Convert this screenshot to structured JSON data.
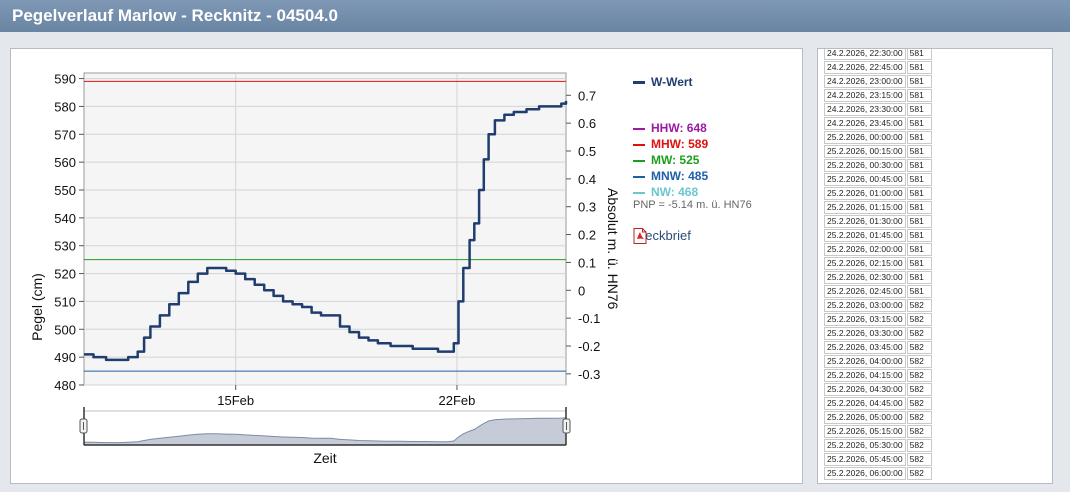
{
  "header": {
    "title": "Pegelverlauf Marlow - Recknitz - 04504.0"
  },
  "chart_data": {
    "type": "line",
    "ylabel": "Pegel (cm)",
    "y2label": "Absolut m. ü. HN76",
    "xlabel": "Zeit",
    "ylim": [
      480,
      592
    ],
    "y_ticks": [
      480,
      490,
      500,
      510,
      520,
      530,
      540,
      550,
      560,
      570,
      580,
      590
    ],
    "y2_ticks": [
      0.7,
      0.6,
      0.5,
      0.4,
      0.3,
      0.2,
      0.1,
      0,
      -0.1,
      -0.2,
      -0.3
    ],
    "y2_tick_labels": [
      "0.7",
      "0.6",
      "0.5",
      "0.4",
      "0.3",
      "0.2",
      "0.1",
      "0",
      "-0.1",
      "-0.2",
      "-0.3"
    ],
    "y2_offset_cm": 514,
    "x_ticks": [
      {
        "label": "15Feb",
        "x": 14.8
      },
      {
        "label": "22Feb",
        "x": 21.8
      }
    ],
    "xlim": [
      10.0,
      25.25
    ],
    "series": [
      {
        "name": "W-Wert",
        "color": "#1f3d6e",
        "points": [
          [
            10.0,
            491
          ],
          [
            10.3,
            490
          ],
          [
            10.7,
            489
          ],
          [
            11.1,
            489
          ],
          [
            11.4,
            490
          ],
          [
            11.7,
            492
          ],
          [
            11.9,
            497
          ],
          [
            12.1,
            501
          ],
          [
            12.4,
            505
          ],
          [
            12.7,
            509
          ],
          [
            13.0,
            513
          ],
          [
            13.3,
            517
          ],
          [
            13.6,
            520
          ],
          [
            13.9,
            522
          ],
          [
            14.2,
            522
          ],
          [
            14.5,
            521
          ],
          [
            14.8,
            520
          ],
          [
            15.1,
            518
          ],
          [
            15.4,
            516
          ],
          [
            15.7,
            514
          ],
          [
            16.0,
            512
          ],
          [
            16.3,
            510
          ],
          [
            16.6,
            509
          ],
          [
            16.9,
            508
          ],
          [
            17.2,
            506
          ],
          [
            17.5,
            505
          ],
          [
            17.8,
            505
          ],
          [
            18.1,
            501
          ],
          [
            18.4,
            499
          ],
          [
            18.7,
            497
          ],
          [
            19.0,
            496
          ],
          [
            19.3,
            495
          ],
          [
            19.7,
            494
          ],
          [
            20.0,
            494
          ],
          [
            20.4,
            493
          ],
          [
            20.8,
            493
          ],
          [
            21.2,
            492
          ],
          [
            21.5,
            492
          ],
          [
            21.7,
            495
          ],
          [
            21.85,
            510
          ],
          [
            22.0,
            522
          ],
          [
            22.2,
            532
          ],
          [
            22.35,
            538
          ],
          [
            22.5,
            550
          ],
          [
            22.65,
            561
          ],
          [
            22.8,
            570
          ],
          [
            23.0,
            575
          ],
          [
            23.3,
            577
          ],
          [
            23.6,
            578
          ],
          [
            24.0,
            579
          ],
          [
            24.4,
            580
          ],
          [
            24.8,
            580
          ],
          [
            25.1,
            581
          ],
          [
            25.25,
            582
          ]
        ]
      }
    ],
    "reference_lines": [
      {
        "name": "HHW",
        "value": 648,
        "color": "#9b1aa3"
      },
      {
        "name": "MHW",
        "value": 589,
        "color": "#e01010"
      },
      {
        "name": "MW",
        "value": 525,
        "color": "#1f9d1f"
      },
      {
        "name": "MNW",
        "value": 485,
        "color": "#1f5fa8"
      },
      {
        "name": "NW",
        "value": 468,
        "color": "#6cc6cf"
      }
    ],
    "legend_placement": "right",
    "grid": true
  },
  "legend": {
    "series_label": "W-Wert",
    "refs": [
      {
        "label": "HHW: 648",
        "color": "#9b1aa3"
      },
      {
        "label": "MHW: 589",
        "color": "#e01010"
      },
      {
        "label": "MW: 525",
        "color": "#1f9d1f"
      },
      {
        "label": "MNW: 485",
        "color": "#1f5fa8"
      },
      {
        "label": "NW: 468",
        "color": "#6cc6cf"
      }
    ],
    "pnp": "PNP = -5.14 m. ü. HN76",
    "steckbrief": "Steckbrief"
  },
  "navigator": {
    "label": "Zeit"
  },
  "table": {
    "rows": [
      [
        "24.2.2026, 22:30:00",
        "581"
      ],
      [
        "24.2.2026, 22:45:00",
        "581"
      ],
      [
        "24.2.2026, 23:00:00",
        "581"
      ],
      [
        "24.2.2026, 23:15:00",
        "581"
      ],
      [
        "24.2.2026, 23:30:00",
        "581"
      ],
      [
        "24.2.2026, 23:45:00",
        "581"
      ],
      [
        "25.2.2026, 00:00:00",
        "581"
      ],
      [
        "25.2.2026, 00:15:00",
        "581"
      ],
      [
        "25.2.2026, 00:30:00",
        "581"
      ],
      [
        "25.2.2026, 00:45:00",
        "581"
      ],
      [
        "25.2.2026, 01:00:00",
        "581"
      ],
      [
        "25.2.2026, 01:15:00",
        "581"
      ],
      [
        "25.2.2026, 01:30:00",
        "581"
      ],
      [
        "25.2.2026, 01:45:00",
        "581"
      ],
      [
        "25.2.2026, 02:00:00",
        "581"
      ],
      [
        "25.2.2026, 02:15:00",
        "581"
      ],
      [
        "25.2.2026, 02:30:00",
        "581"
      ],
      [
        "25.2.2026, 02:45:00",
        "581"
      ],
      [
        "25.2.2026, 03:00:00",
        "582"
      ],
      [
        "25.2.2026, 03:15:00",
        "582"
      ],
      [
        "25.2.2026, 03:30:00",
        "582"
      ],
      [
        "25.2.2026, 03:45:00",
        "582"
      ],
      [
        "25.2.2026, 04:00:00",
        "582"
      ],
      [
        "25.2.2026, 04:15:00",
        "582"
      ],
      [
        "25.2.2026, 04:30:00",
        "582"
      ],
      [
        "25.2.2026, 04:45:00",
        "582"
      ],
      [
        "25.2.2026, 05:00:00",
        "582"
      ],
      [
        "25.2.2026, 05:15:00",
        "582"
      ],
      [
        "25.2.2026, 05:30:00",
        "582"
      ],
      [
        "25.2.2026, 05:45:00",
        "582"
      ],
      [
        "25.2.2026, 06:00:00",
        "582"
      ]
    ]
  }
}
